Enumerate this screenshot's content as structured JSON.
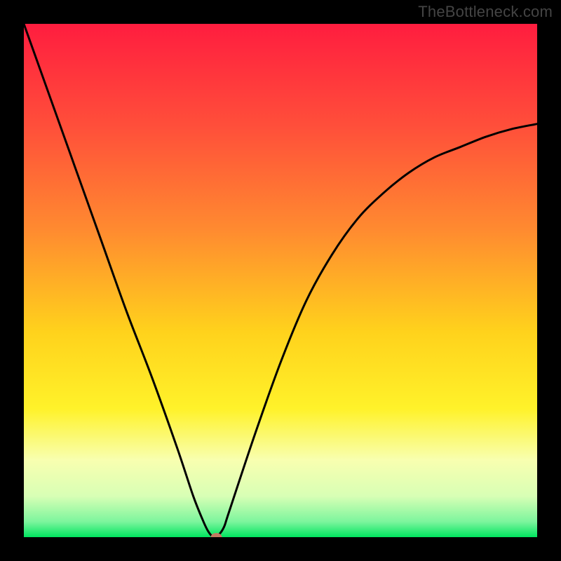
{
  "watermark": "TheBottleneck.com",
  "chart_data": {
    "type": "line",
    "title": "",
    "xlabel": "",
    "ylabel": "",
    "xlim": [
      0,
      100
    ],
    "ylim": [
      0,
      100
    ],
    "x": [
      0,
      5,
      10,
      15,
      20,
      25,
      30,
      33,
      35,
      36,
      37,
      38,
      39,
      40,
      45,
      50,
      55,
      60,
      65,
      70,
      75,
      80,
      85,
      90,
      95,
      100
    ],
    "values": [
      100,
      86,
      72,
      58,
      44,
      31,
      17,
      8,
      3,
      1,
      0,
      0.5,
      2,
      5,
      20,
      34,
      46,
      55,
      62,
      67,
      71,
      74,
      76,
      78,
      79.5,
      80.5
    ],
    "marker": {
      "x": 37.5,
      "y": 0
    },
    "gradient_stops": [
      {
        "pos": 0,
        "color": "#ff1d3f"
      },
      {
        "pos": 20,
        "color": "#ff4f3a"
      },
      {
        "pos": 40,
        "color": "#ff8a30"
      },
      {
        "pos": 60,
        "color": "#ffd21c"
      },
      {
        "pos": 75,
        "color": "#fff22a"
      },
      {
        "pos": 85,
        "color": "#f8ffb0"
      },
      {
        "pos": 92,
        "color": "#d8ffb5"
      },
      {
        "pos": 97,
        "color": "#7cf59d"
      },
      {
        "pos": 100,
        "color": "#00e55f"
      }
    ],
    "colors": {
      "background": "#000000",
      "curve": "#000000",
      "marker": "#c27a61"
    }
  }
}
